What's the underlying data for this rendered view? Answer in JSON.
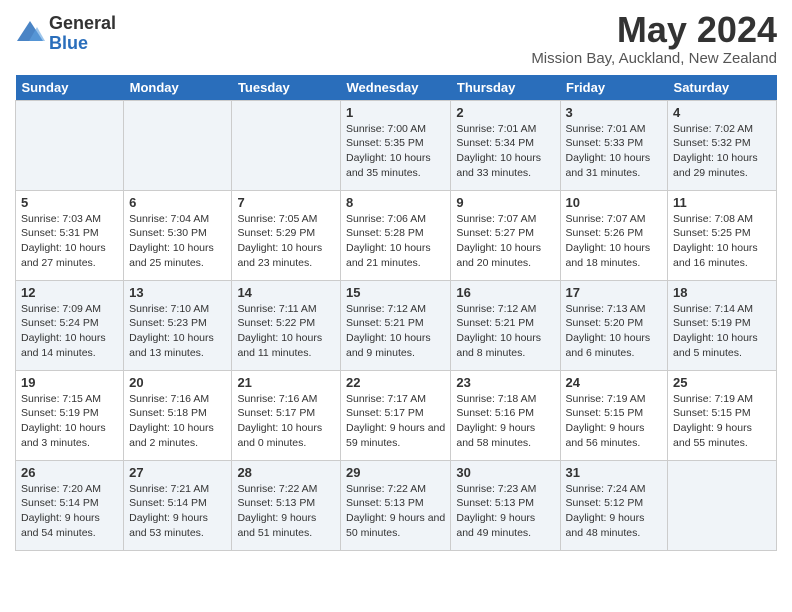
{
  "header": {
    "logo_line1": "General",
    "logo_line2": "Blue",
    "month_title": "May 2024",
    "location": "Mission Bay, Auckland, New Zealand"
  },
  "weekdays": [
    "Sunday",
    "Monday",
    "Tuesday",
    "Wednesday",
    "Thursday",
    "Friday",
    "Saturday"
  ],
  "weeks": [
    [
      {
        "num": "",
        "sunrise": "",
        "sunset": "",
        "daylight": ""
      },
      {
        "num": "",
        "sunrise": "",
        "sunset": "",
        "daylight": ""
      },
      {
        "num": "",
        "sunrise": "",
        "sunset": "",
        "daylight": ""
      },
      {
        "num": "1",
        "sunrise": "Sunrise: 7:00 AM",
        "sunset": "Sunset: 5:35 PM",
        "daylight": "Daylight: 10 hours and 35 minutes."
      },
      {
        "num": "2",
        "sunrise": "Sunrise: 7:01 AM",
        "sunset": "Sunset: 5:34 PM",
        "daylight": "Daylight: 10 hours and 33 minutes."
      },
      {
        "num": "3",
        "sunrise": "Sunrise: 7:01 AM",
        "sunset": "Sunset: 5:33 PM",
        "daylight": "Daylight: 10 hours and 31 minutes."
      },
      {
        "num": "4",
        "sunrise": "Sunrise: 7:02 AM",
        "sunset": "Sunset: 5:32 PM",
        "daylight": "Daylight: 10 hours and 29 minutes."
      }
    ],
    [
      {
        "num": "5",
        "sunrise": "Sunrise: 7:03 AM",
        "sunset": "Sunset: 5:31 PM",
        "daylight": "Daylight: 10 hours and 27 minutes."
      },
      {
        "num": "6",
        "sunrise": "Sunrise: 7:04 AM",
        "sunset": "Sunset: 5:30 PM",
        "daylight": "Daylight: 10 hours and 25 minutes."
      },
      {
        "num": "7",
        "sunrise": "Sunrise: 7:05 AM",
        "sunset": "Sunset: 5:29 PM",
        "daylight": "Daylight: 10 hours and 23 minutes."
      },
      {
        "num": "8",
        "sunrise": "Sunrise: 7:06 AM",
        "sunset": "Sunset: 5:28 PM",
        "daylight": "Daylight: 10 hours and 21 minutes."
      },
      {
        "num": "9",
        "sunrise": "Sunrise: 7:07 AM",
        "sunset": "Sunset: 5:27 PM",
        "daylight": "Daylight: 10 hours and 20 minutes."
      },
      {
        "num": "10",
        "sunrise": "Sunrise: 7:07 AM",
        "sunset": "Sunset: 5:26 PM",
        "daylight": "Daylight: 10 hours and 18 minutes."
      },
      {
        "num": "11",
        "sunrise": "Sunrise: 7:08 AM",
        "sunset": "Sunset: 5:25 PM",
        "daylight": "Daylight: 10 hours and 16 minutes."
      }
    ],
    [
      {
        "num": "12",
        "sunrise": "Sunrise: 7:09 AM",
        "sunset": "Sunset: 5:24 PM",
        "daylight": "Daylight: 10 hours and 14 minutes."
      },
      {
        "num": "13",
        "sunrise": "Sunrise: 7:10 AM",
        "sunset": "Sunset: 5:23 PM",
        "daylight": "Daylight: 10 hours and 13 minutes."
      },
      {
        "num": "14",
        "sunrise": "Sunrise: 7:11 AM",
        "sunset": "Sunset: 5:22 PM",
        "daylight": "Daylight: 10 hours and 11 minutes."
      },
      {
        "num": "15",
        "sunrise": "Sunrise: 7:12 AM",
        "sunset": "Sunset: 5:21 PM",
        "daylight": "Daylight: 10 hours and 9 minutes."
      },
      {
        "num": "16",
        "sunrise": "Sunrise: 7:12 AM",
        "sunset": "Sunset: 5:21 PM",
        "daylight": "Daylight: 10 hours and 8 minutes."
      },
      {
        "num": "17",
        "sunrise": "Sunrise: 7:13 AM",
        "sunset": "Sunset: 5:20 PM",
        "daylight": "Daylight: 10 hours and 6 minutes."
      },
      {
        "num": "18",
        "sunrise": "Sunrise: 7:14 AM",
        "sunset": "Sunset: 5:19 PM",
        "daylight": "Daylight: 10 hours and 5 minutes."
      }
    ],
    [
      {
        "num": "19",
        "sunrise": "Sunrise: 7:15 AM",
        "sunset": "Sunset: 5:19 PM",
        "daylight": "Daylight: 10 hours and 3 minutes."
      },
      {
        "num": "20",
        "sunrise": "Sunrise: 7:16 AM",
        "sunset": "Sunset: 5:18 PM",
        "daylight": "Daylight: 10 hours and 2 minutes."
      },
      {
        "num": "21",
        "sunrise": "Sunrise: 7:16 AM",
        "sunset": "Sunset: 5:17 PM",
        "daylight": "Daylight: 10 hours and 0 minutes."
      },
      {
        "num": "22",
        "sunrise": "Sunrise: 7:17 AM",
        "sunset": "Sunset: 5:17 PM",
        "daylight": "Daylight: 9 hours and 59 minutes."
      },
      {
        "num": "23",
        "sunrise": "Sunrise: 7:18 AM",
        "sunset": "Sunset: 5:16 PM",
        "daylight": "Daylight: 9 hours and 58 minutes."
      },
      {
        "num": "24",
        "sunrise": "Sunrise: 7:19 AM",
        "sunset": "Sunset: 5:15 PM",
        "daylight": "Daylight: 9 hours and 56 minutes."
      },
      {
        "num": "25",
        "sunrise": "Sunrise: 7:19 AM",
        "sunset": "Sunset: 5:15 PM",
        "daylight": "Daylight: 9 hours and 55 minutes."
      }
    ],
    [
      {
        "num": "26",
        "sunrise": "Sunrise: 7:20 AM",
        "sunset": "Sunset: 5:14 PM",
        "daylight": "Daylight: 9 hours and 54 minutes."
      },
      {
        "num": "27",
        "sunrise": "Sunrise: 7:21 AM",
        "sunset": "Sunset: 5:14 PM",
        "daylight": "Daylight: 9 hours and 53 minutes."
      },
      {
        "num": "28",
        "sunrise": "Sunrise: 7:22 AM",
        "sunset": "Sunset: 5:13 PM",
        "daylight": "Daylight: 9 hours and 51 minutes."
      },
      {
        "num": "29",
        "sunrise": "Sunrise: 7:22 AM",
        "sunset": "Sunset: 5:13 PM",
        "daylight": "Daylight: 9 hours and 50 minutes."
      },
      {
        "num": "30",
        "sunrise": "Sunrise: 7:23 AM",
        "sunset": "Sunset: 5:13 PM",
        "daylight": "Daylight: 9 hours and 49 minutes."
      },
      {
        "num": "31",
        "sunrise": "Sunrise: 7:24 AM",
        "sunset": "Sunset: 5:12 PM",
        "daylight": "Daylight: 9 hours and 48 minutes."
      },
      {
        "num": "",
        "sunrise": "",
        "sunset": "",
        "daylight": ""
      }
    ]
  ]
}
